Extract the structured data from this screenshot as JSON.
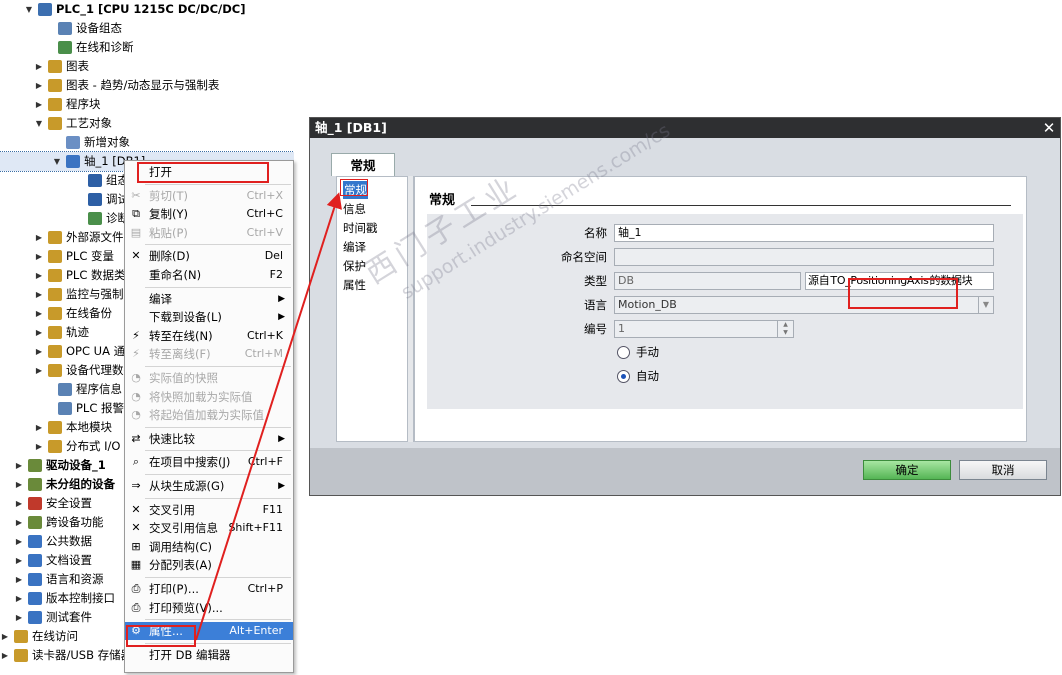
{
  "tree": {
    "items": [
      {
        "label": "PLC_1 [CPU 1215C DC/DC/DC]",
        "bold": true,
        "expander": "▼",
        "icon_color": "#3c6fb0",
        "icon": "plc-icon"
      },
      {
        "label": "设备组态",
        "expander": "",
        "icon_color": "#5a82b4",
        "icon": "device-config-icon"
      },
      {
        "label": "在线和诊断",
        "expander": "",
        "icon_color": "#4a8f4a",
        "icon": "online-diagnostics-icon"
      },
      {
        "label": "图表",
        "expander": "▶",
        "icon_color": "#c89a2a",
        "icon": "folder-icon"
      },
      {
        "label": "图表 - 趋势/动态显示与强制表",
        "expander": "▶",
        "icon_color": "#c89a2a",
        "icon": "folder-icon"
      },
      {
        "label": "程序块",
        "expander": "▶",
        "icon_color": "#c89a2a",
        "icon": "folder-icon"
      },
      {
        "label": "工艺对象",
        "expander": "▼",
        "icon_color": "#c89a2a",
        "icon": "folder-icon"
      },
      {
        "label": "新增对象",
        "expander": "",
        "icon_color": "#6b8fc4",
        "icon": "add-object-icon"
      },
      {
        "label": "轴_1 [DB1]",
        "expander": "▼",
        "icon_color": "#3a73c2",
        "icon": "axis-icon",
        "selected": true
      },
      {
        "label": "组态",
        "expander": "",
        "icon_color": "#2d5fa5",
        "icon": "config-icon"
      },
      {
        "label": "调试",
        "expander": "",
        "icon_color": "#2d5fa5",
        "icon": "commissioning-icon"
      },
      {
        "label": "诊断",
        "expander": "",
        "icon_color": "#4a8f4a",
        "icon": "diagnostics-icon"
      },
      {
        "label": "外部源文件",
        "expander": "▶",
        "icon_color": "#c89a2a",
        "icon": "folder-icon"
      },
      {
        "label": "PLC 变量",
        "expander": "▶",
        "icon_color": "#c89a2a",
        "icon": "folder-icon"
      },
      {
        "label": "PLC 数据类型",
        "expander": "▶",
        "icon_color": "#c89a2a",
        "icon": "folder-icon"
      },
      {
        "label": "监控与强制表",
        "expander": "▶",
        "icon_color": "#c89a2a",
        "icon": "folder-icon"
      },
      {
        "label": "在线备份",
        "expander": "▶",
        "icon_color": "#c89a2a",
        "icon": "folder-icon"
      },
      {
        "label": "轨迹",
        "expander": "▶",
        "icon_color": "#c89a2a",
        "icon": "folder-icon"
      },
      {
        "label": "OPC UA 通信",
        "expander": "▶",
        "icon_color": "#c89a2a",
        "icon": "folder-icon"
      },
      {
        "label": "设备代理数据",
        "expander": "▶",
        "icon_color": "#c89a2a",
        "icon": "folder-icon"
      },
      {
        "label": "程序信息",
        "expander": "",
        "icon_color": "#5a82b4",
        "icon": "program-info-icon"
      },
      {
        "label": "PLC 报警文本列表",
        "expander": "",
        "icon_color": "#5a82b4",
        "icon": "alarm-text-icon"
      },
      {
        "label": "本地模块",
        "expander": "▶",
        "icon_color": "#c89a2a",
        "icon": "folder-icon"
      },
      {
        "label": "分布式 I/O",
        "expander": "▶",
        "icon_color": "#c89a2a",
        "icon": "folder-icon"
      },
      {
        "label": "驱动设备_1",
        "bold": true,
        "expander": "▶",
        "icon_color": "#6a8a3a",
        "icon": "drive-icon"
      },
      {
        "label": "未分组的设备",
        "bold": true,
        "expander": "▶",
        "icon_color": "#6a8a3a",
        "icon": "ungrouped-icon"
      },
      {
        "label": "安全设置",
        "expander": "▶",
        "icon_color": "#c0392b",
        "icon": "security-icon"
      },
      {
        "label": "跨设备功能",
        "expander": "▶",
        "icon_color": "#6a8a3a",
        "icon": "cross-device-icon"
      },
      {
        "label": "公共数据",
        "expander": "▶",
        "icon_color": "#3a73c2",
        "icon": "common-data-icon"
      },
      {
        "label": "文档设置",
        "expander": "▶",
        "icon_color": "#3a73c2",
        "icon": "document-icon"
      },
      {
        "label": "语言和资源",
        "expander": "▶",
        "icon_color": "#3a73c2",
        "icon": "language-icon"
      },
      {
        "label": "版本控制接口",
        "expander": "▶",
        "icon_color": "#3a73c2",
        "icon": "version-icon"
      },
      {
        "label": "测试套件",
        "expander": "▶",
        "icon_color": "#3a73c2",
        "icon": "test-icon"
      },
      {
        "label": "在线访问",
        "expander": "▶",
        "icon_color": "#c89a2a",
        "icon": "online-access-icon"
      },
      {
        "label": "读卡器/USB 存储器",
        "expander": "▶",
        "icon_color": "#c89a2a",
        "icon": "card-reader-icon"
      }
    ]
  },
  "context_menu": {
    "items": [
      {
        "label": "打开",
        "shortcut": "",
        "icon": "",
        "disabled": false,
        "boxed": true
      },
      {
        "sep": true
      },
      {
        "label": "剪切(T)",
        "shortcut": "Ctrl+X",
        "icon": "✂",
        "icon_name": "cut-icon",
        "disabled": true
      },
      {
        "label": "复制(Y)",
        "shortcut": "Ctrl+C",
        "icon": "⧉",
        "icon_name": "copy-icon",
        "disabled": false
      },
      {
        "label": "粘贴(P)",
        "shortcut": "Ctrl+V",
        "icon": "▤",
        "icon_name": "paste-icon",
        "disabled": true
      },
      {
        "sep": true
      },
      {
        "label": "删除(D)",
        "shortcut": "Del",
        "icon": "✕",
        "icon_name": "delete-icon",
        "disabled": false
      },
      {
        "label": "重命名(N)",
        "shortcut": "F2",
        "icon": "",
        "disabled": false
      },
      {
        "sep": true
      },
      {
        "label": "编译",
        "shortcut": "",
        "arrow": "▶",
        "icon": "",
        "disabled": false
      },
      {
        "label": "下载到设备(L)",
        "shortcut": "",
        "arrow": "▶",
        "icon": "",
        "disabled": false
      },
      {
        "label": "转至在线(N)",
        "shortcut": "Ctrl+K",
        "icon": "⚡",
        "icon_name": "go-online-icon",
        "disabled": false
      },
      {
        "label": "转至离线(F)",
        "shortcut": "Ctrl+M",
        "icon": "⚡",
        "icon_name": "go-offline-icon",
        "disabled": true
      },
      {
        "sep": true
      },
      {
        "label": "实际值的快照",
        "shortcut": "",
        "icon": "◔",
        "icon_name": "snapshot-icon",
        "disabled": true
      },
      {
        "label": "将快照加载为实际值",
        "shortcut": "",
        "icon": "◔",
        "icon_name": "load-snapshot-icon",
        "disabled": true
      },
      {
        "label": "将起始值加载为实际值",
        "shortcut": "",
        "icon": "◔",
        "icon_name": "load-start-value-icon",
        "disabled": true
      },
      {
        "sep": true
      },
      {
        "label": "快速比较",
        "shortcut": "",
        "arrow": "▶",
        "icon": "⇄",
        "icon_name": "compare-icon",
        "disabled": false
      },
      {
        "sep": true
      },
      {
        "label": "在项目中搜索(J)",
        "shortcut": "Ctrl+F",
        "icon": "⌕",
        "icon_name": "search-icon",
        "disabled": false
      },
      {
        "sep": true
      },
      {
        "label": "从块生成源(G)",
        "shortcut": "",
        "arrow": "▶",
        "icon": "⇒",
        "icon_name": "generate-source-icon",
        "disabled": false
      },
      {
        "sep": true
      },
      {
        "label": "交叉引用",
        "shortcut": "F11",
        "icon": "✕",
        "icon_name": "cross-ref-icon",
        "disabled": false
      },
      {
        "label": "交叉引用信息",
        "shortcut": "Shift+F11",
        "icon": "✕",
        "icon_name": "cross-ref-info-icon",
        "disabled": false
      },
      {
        "label": "调用结构(C)",
        "shortcut": "",
        "icon": "⊞",
        "icon_name": "call-structure-icon",
        "disabled": false
      },
      {
        "label": "分配列表(A)",
        "shortcut": "",
        "icon": "▦",
        "icon_name": "assignment-list-icon",
        "disabled": false
      },
      {
        "sep": true
      },
      {
        "label": "打印(P)...",
        "shortcut": "Ctrl+P",
        "icon": "⎙",
        "icon_name": "print-icon",
        "disabled": false
      },
      {
        "label": "打印预览(V)...",
        "shortcut": "",
        "icon": "⎙",
        "icon_name": "print-preview-icon",
        "disabled": false
      },
      {
        "sep": true
      },
      {
        "label": "属性...",
        "shortcut": "Alt+Enter",
        "icon": "⚙",
        "icon_name": "properties-icon",
        "disabled": false,
        "highlight": true,
        "boxed": true
      },
      {
        "sep": true
      },
      {
        "label": "打开 DB 编辑器",
        "shortcut": "",
        "icon": "",
        "disabled": false
      }
    ]
  },
  "dialog": {
    "title": "轴_1 [DB1]",
    "close": "✕",
    "tab": "常规",
    "nav": [
      "常规",
      "信息",
      "时间戳",
      "编译",
      "保护",
      "属性"
    ],
    "section_title": "常规",
    "fields": {
      "name_label": "名称",
      "name_value": "轴_1",
      "namespace_label": "命名空间",
      "namespace_value": "",
      "type_label": "类型",
      "type_value": "DB",
      "type_source_prefix": "源自",
      "type_source_value": "TO_PositioningAxis",
      "type_source_suffix": "的数据块",
      "language_label": "语言",
      "language_value": "Motion_DB",
      "number_label": "编号",
      "number_value": "1",
      "manual_label": "手动",
      "auto_label": "自动"
    },
    "ok_label": "确定",
    "cancel_label": "取消"
  },
  "watermark": {
    "line1": "西门子工业",
    "line2": "support.industry.siemens.com/cs"
  },
  "colors": {
    "highlight": "#3c7fd8",
    "annotation_red": "#e0201f",
    "ok_green": "#55b555",
    "titlebar": "#2e2f31"
  }
}
